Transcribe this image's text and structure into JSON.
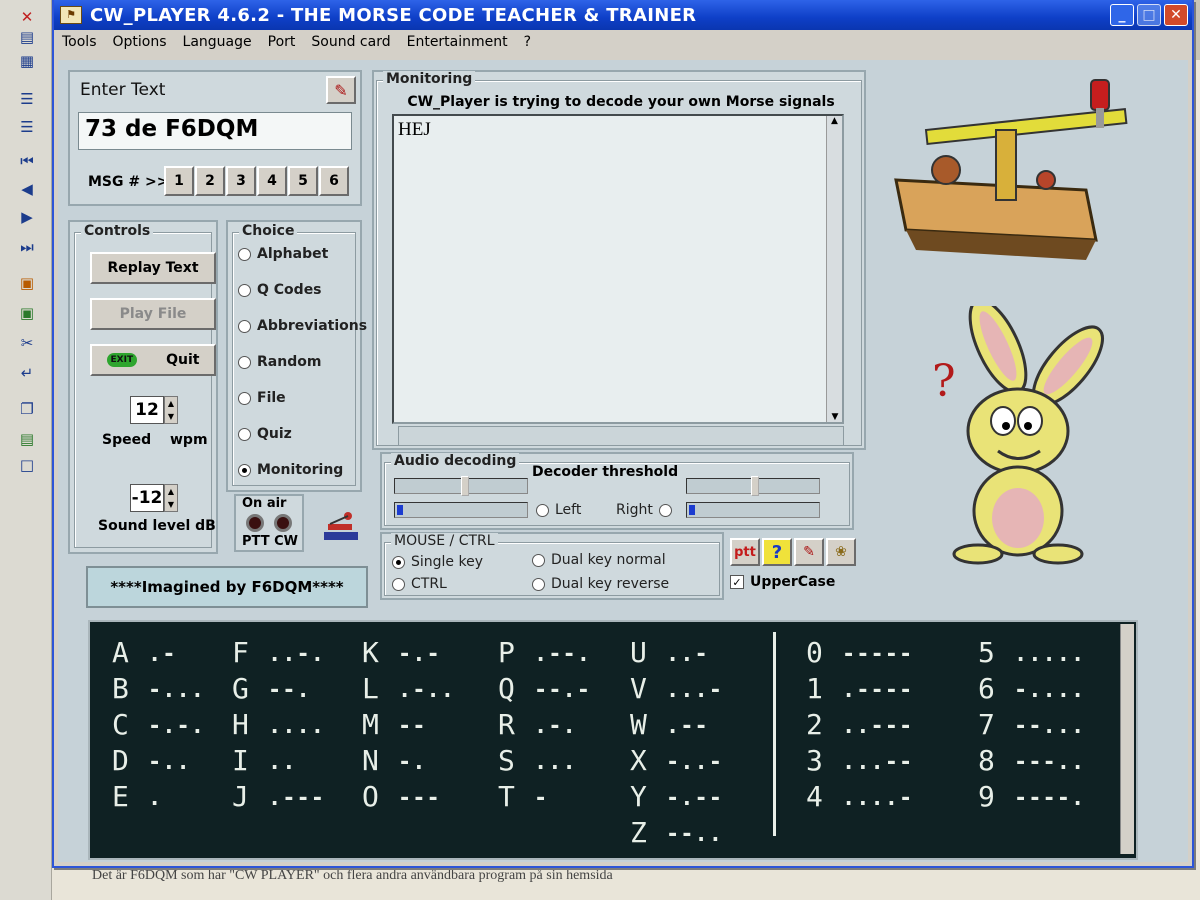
{
  "window": {
    "title": "CW_PLAYER 4.6.2 - THE  MORSE  CODE  TEACHER  &  TRAINER",
    "min": "_",
    "max": "□",
    "close": "✕"
  },
  "menu": [
    "Tools",
    "Options",
    "Language",
    "Port",
    "Sound card",
    "Entertainment",
    "?"
  ],
  "enter_text": {
    "label": "Enter Text",
    "value": "73 de F6DQM",
    "msg_label": "MSG # >>",
    "msg_buttons": [
      "1",
      "2",
      "3",
      "4",
      "5",
      "6"
    ]
  },
  "monitoring": {
    "label": "Monitoring",
    "caption": "CW_Player is trying to decode your own Morse signals",
    "decoded_text": "HEJ"
  },
  "controls": {
    "label": "Controls",
    "replay": "Replay Text",
    "play_file": "Play File",
    "quit": "Quit",
    "quit_icon_text": "EXIT",
    "speed_value": "12",
    "speed_label": "Speed",
    "speed_unit": "wpm",
    "sound_value": "-12",
    "sound_label": "Sound level dB"
  },
  "choice": {
    "label": "Choice",
    "options": [
      "Alphabet",
      "Q Codes",
      "Abbreviations",
      "Random",
      "File",
      "Quiz",
      "Monitoring"
    ],
    "selected": "Monitoring"
  },
  "on_air": {
    "label": "On air",
    "sub": "PTT CW"
  },
  "credit": "****Imagined by F6DQM****",
  "audio": {
    "label": "Audio decoding",
    "threshold_label": "Decoder threshold",
    "left": "Left",
    "right": "Right"
  },
  "mouse": {
    "label": "MOUSE / CTRL",
    "options": [
      "Single key",
      "CTRL",
      "Dual key normal",
      "Dual key reverse"
    ],
    "selected": "Single key"
  },
  "tools": {
    "ptt": "ptt",
    "help": "?",
    "uppercase": "UpperCase",
    "uppercase_checked": true
  },
  "morse": [
    {
      "l": "A",
      "c": ".-"
    },
    {
      "l": "B",
      "c": "-..."
    },
    {
      "l": "C",
      "c": "-.-."
    },
    {
      "l": "D",
      "c": "-.."
    },
    {
      "l": "E",
      "c": "."
    },
    {
      "l": "F",
      "c": "..-."
    },
    {
      "l": "G",
      "c": "--."
    },
    {
      "l": "H",
      "c": "...."
    },
    {
      "l": "I",
      "c": ".."
    },
    {
      "l": "J",
      "c": ".---"
    },
    {
      "l": "K",
      "c": "-.-"
    },
    {
      "l": "L",
      "c": ".-.."
    },
    {
      "l": "M",
      "c": "--"
    },
    {
      "l": "N",
      "c": "-."
    },
    {
      "l": "O",
      "c": "---"
    },
    {
      "l": "P",
      "c": ".--."
    },
    {
      "l": "Q",
      "c": "--.-"
    },
    {
      "l": "R",
      "c": ".-."
    },
    {
      "l": "S",
      "c": "..."
    },
    {
      "l": "T",
      "c": "-"
    },
    {
      "l": "U",
      "c": "..-"
    },
    {
      "l": "V",
      "c": "...-"
    },
    {
      "l": "W",
      "c": ".--"
    },
    {
      "l": "X",
      "c": "-..-"
    },
    {
      "l": "Y",
      "c": "-.--"
    },
    {
      "l": "Z",
      "c": "--.."
    },
    {
      "l": "0",
      "c": "-----"
    },
    {
      "l": "1",
      "c": ".----"
    },
    {
      "l": "2",
      "c": "..---"
    },
    {
      "l": "3",
      "c": "...--"
    },
    {
      "l": "4",
      "c": "....-"
    },
    {
      "l": "5",
      "c": "....."
    },
    {
      "l": "6",
      "c": "-...."
    },
    {
      "l": "7",
      "c": "--..."
    },
    {
      "l": "8",
      "c": "---.."
    },
    {
      "l": "9",
      "c": "----."
    }
  ],
  "background_doc": "Det är F6DQM som har \"CW PLAYER\" och flera andra användbara program på sin hemsida"
}
